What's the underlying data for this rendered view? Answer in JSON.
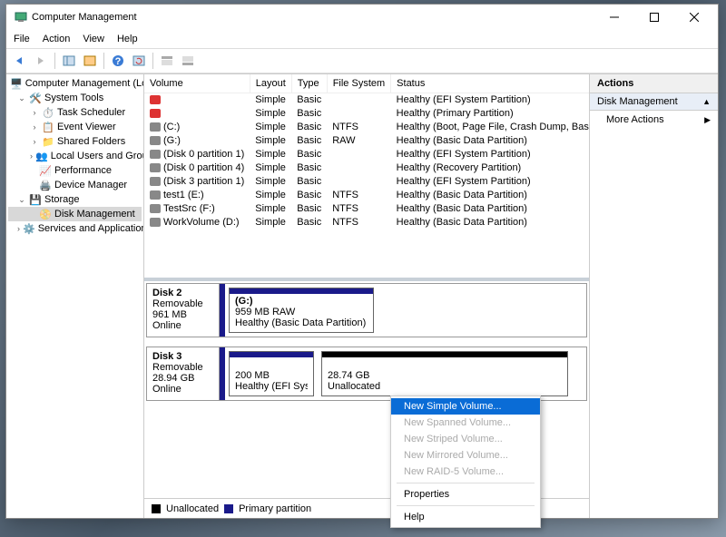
{
  "window": {
    "title": "Computer Management"
  },
  "menu": {
    "file": "File",
    "action": "Action",
    "view": "View",
    "help": "Help"
  },
  "tree": {
    "root": "Computer Management (Local)",
    "system_tools": "System Tools",
    "st": {
      "task_scheduler": "Task Scheduler",
      "event_viewer": "Event Viewer",
      "shared_folders": "Shared Folders",
      "local_users": "Local Users and Groups",
      "performance": "Performance",
      "device_manager": "Device Manager"
    },
    "storage": "Storage",
    "disk_mgmt": "Disk Management",
    "services_apps": "Services and Applications"
  },
  "vol_headers": {
    "volume": "Volume",
    "layout": "Layout",
    "type": "Type",
    "fs": "File System",
    "status": "Status"
  },
  "volumes": [
    {
      "name": "",
      "layout": "Simple",
      "type": "Basic",
      "fs": "",
      "status": "Healthy (EFI System Partition)",
      "sys": true
    },
    {
      "name": "",
      "layout": "Simple",
      "type": "Basic",
      "fs": "",
      "status": "Healthy (Primary Partition)",
      "sys": true
    },
    {
      "name": "(C:)",
      "layout": "Simple",
      "type": "Basic",
      "fs": "NTFS",
      "status": "Healthy (Boot, Page File, Crash Dump, Basic Data Partition)"
    },
    {
      "name": "(G:)",
      "layout": "Simple",
      "type": "Basic",
      "fs": "RAW",
      "status": "Healthy (Basic Data Partition)"
    },
    {
      "name": "(Disk 0 partition 1)",
      "layout": "Simple",
      "type": "Basic",
      "fs": "",
      "status": "Healthy (EFI System Partition)"
    },
    {
      "name": "(Disk 0 partition 4)",
      "layout": "Simple",
      "type": "Basic",
      "fs": "",
      "status": "Healthy (Recovery Partition)"
    },
    {
      "name": "(Disk 3 partition 1)",
      "layout": "Simple",
      "type": "Basic",
      "fs": "",
      "status": "Healthy (EFI System Partition)"
    },
    {
      "name": "test1 (E:)",
      "layout": "Simple",
      "type": "Basic",
      "fs": "NTFS",
      "status": "Healthy (Basic Data Partition)"
    },
    {
      "name": "TestSrc (F:)",
      "layout": "Simple",
      "type": "Basic",
      "fs": "NTFS",
      "status": "Healthy (Basic Data Partition)"
    },
    {
      "name": "WorkVolume (D:)",
      "layout": "Simple",
      "type": "Basic",
      "fs": "NTFS",
      "status": "Healthy (Basic Data Partition)"
    }
  ],
  "disk2": {
    "name": "Disk 2",
    "removable": "Removable",
    "size": "961 MB",
    "state": "Online",
    "part": {
      "name": "(G:)",
      "l1": "959 MB RAW",
      "l2": "Healthy (Basic Data Partition)"
    }
  },
  "disk3": {
    "name": "Disk 3",
    "removable": "Removable",
    "size": "28.94 GB",
    "state": "Online",
    "p1": {
      "l1": "200 MB",
      "l2": "Healthy (EFI System Partition)"
    },
    "p2": {
      "l1": "28.74 GB",
      "l2": "Unallocated"
    }
  },
  "legend": {
    "unalloc": "Unallocated",
    "primary": "Primary partition"
  },
  "actions": {
    "header": "Actions",
    "section": "Disk Management",
    "more": "More Actions"
  },
  "ctx": {
    "new_simple": "New Simple Volume...",
    "new_spanned": "New Spanned Volume...",
    "new_striped": "New Striped Volume...",
    "new_mirrored": "New Mirrored Volume...",
    "new_raid5": "New RAID-5 Volume...",
    "properties": "Properties",
    "help": "Help"
  }
}
